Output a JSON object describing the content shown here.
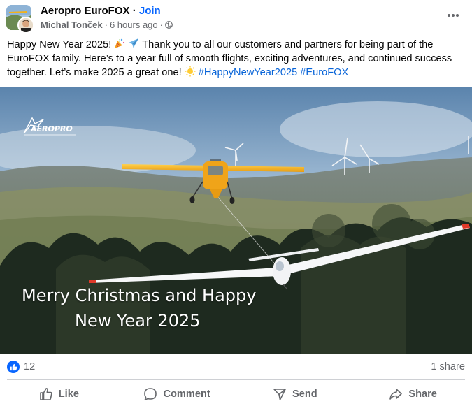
{
  "post": {
    "group_name": "Aeropro EuroFOX",
    "separator": "·",
    "join_label": "Join",
    "author": "Michal Tonček",
    "time": "6 hours ago",
    "text_part1": "Happy New Year 2025! ",
    "text_part2": " Thank you to all our customers and partners for being part of the EuroFOX family. Here’s to a year full of smooth flights, exciting adventures, and continued success together. Let’s make 2025 a great one! ",
    "hashtag1": "#HappyNewYear2025",
    "hashtag2": "#EuroFOX"
  },
  "image": {
    "logo_text": "AEROPRO",
    "greeting_line1": "Merry Christmas and Happy",
    "greeting_line2": "New Year 2025"
  },
  "stats": {
    "reaction_count": "12",
    "shares": "1 share"
  },
  "actions": {
    "like": "Like",
    "comment": "Comment",
    "send": "Send",
    "share": "Share"
  },
  "colors": {
    "accent": "#0866ff",
    "hashtag": "#0864d8",
    "secondary_text": "#65676b"
  },
  "icons": [
    "globe-icon",
    "more-icon",
    "party-popper-icon",
    "airplane-icon",
    "sun-icon",
    "like-reaction-icon",
    "thumbs-up-icon",
    "comment-icon",
    "send-icon",
    "share-icon"
  ]
}
